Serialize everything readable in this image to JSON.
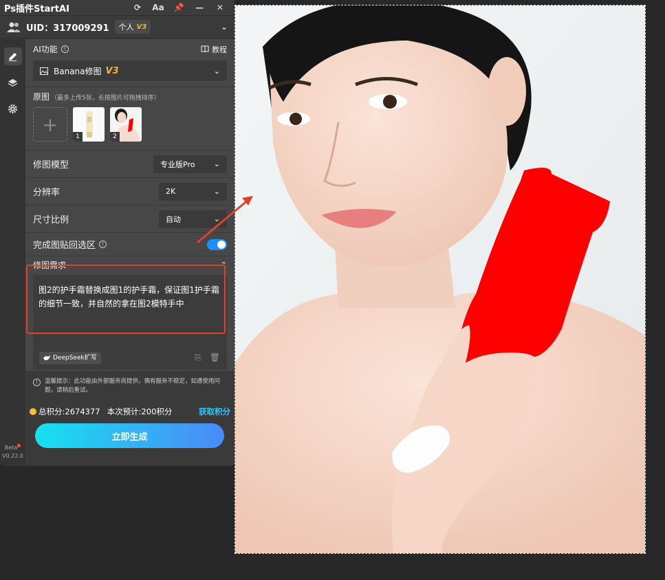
{
  "titlebar": {
    "title": "Ps插件StartAI",
    "icons": [
      "refresh-icon",
      "font-icon",
      "pin-icon",
      "minimize-icon",
      "close-icon"
    ],
    "font_label": "Aa"
  },
  "user": {
    "uid": "UID：317009291",
    "plan": "个人",
    "version_badge": "V3"
  },
  "ai_function": {
    "label": "AI功能",
    "tutorial": "教程",
    "selected": "Banana修图",
    "selected_badge": "V3"
  },
  "images": {
    "label": "原图",
    "hint": "（最多上传5张，长按图片可拖拽排序）",
    "thumbs": [
      {
        "num": "1"
      },
      {
        "num": "2"
      }
    ]
  },
  "settings": {
    "model_label": "修图模型",
    "model_value": "专业版Pro",
    "resolution_label": "分辨率",
    "resolution_value": "2K",
    "ratio_label": "尺寸比例",
    "ratio_value": "自动",
    "paste_label": "完成图贴回选区",
    "paste_on": true
  },
  "request": {
    "label": "修图需求",
    "text": "图2的护手霜替换成图1的护手霜，保证图1护手霜的细节一致，并自然的拿在图2模特手中",
    "deepseek_label": "DeepSeek扩写"
  },
  "tip": "温馨提示：此功能由外部服务商提供，偶有服务不稳定，如遇使用问题，请稍后重试。",
  "points": {
    "total": "总积分:2674377",
    "estimate": "本次预计:200积分",
    "get": "获取积分"
  },
  "generate_label": "立即生成",
  "version": {
    "beta": "Beta",
    "number": "V0.22.0"
  },
  "colors": {
    "accent": "#1a8fff",
    "highlight": "#e0412b",
    "mask": "#ff0000",
    "gold": "#f0b23a"
  }
}
